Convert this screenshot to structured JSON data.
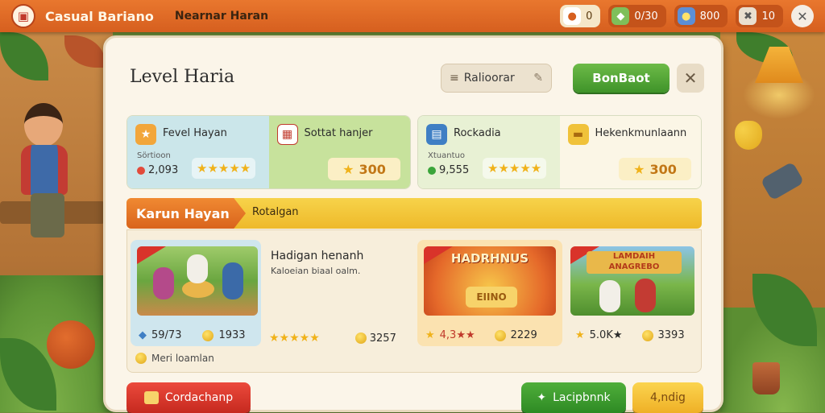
{
  "topbar": {
    "app_title": "Casual Bariano",
    "sub_title": "Nearnar Haran",
    "stats": [
      {
        "icon": "ticket-icon",
        "value": "0",
        "bg": "#f5e6c8"
      },
      {
        "icon": "gem-icon",
        "value": "0/30",
        "bg": "#7fbf5a"
      },
      {
        "icon": "coins-icon",
        "value": "800",
        "bg": "#5c8fd6"
      },
      {
        "icon": "tools-icon",
        "value": "10",
        "bg": "#e9dfcf"
      }
    ]
  },
  "header": {
    "title": "Level Haria",
    "search_value": "Ralioorar",
    "primary_button": "BonBaot"
  },
  "cards": [
    {
      "left": {
        "label": "Fevel Hayan",
        "small": "Sörtioon",
        "value": "2,093",
        "dot_color": "#e24b3b"
      },
      "right": {
        "label": "Sottat hanjer",
        "coins": "300"
      }
    },
    {
      "left": {
        "label": "Rockadia",
        "small": "Xtuantuo",
        "value": "9,555",
        "dot_color": "#3aa53a"
      },
      "right": {
        "label": "Hekenkmunlaann",
        "coins": "300"
      }
    }
  ],
  "section": {
    "tag": "Karun Hayan",
    "text": "Rotalgan"
  },
  "items": [
    {
      "thumb_text": "",
      "left_value": "59/73",
      "coin_value": "1933"
    },
    {
      "title": "Hadigan henanh",
      "desc": "Kaloeian biaal oalm.",
      "stars": "★★★★★",
      "coin_value": "3257"
    },
    {
      "thumb_text": "HADRHNUS",
      "thumb_sub": "EIINO",
      "rating": "4,3★★",
      "coin_value": "2229"
    },
    {
      "thumb_text": "LAMDAIH ANAGREBO",
      "rating": "5.0K★",
      "coin_value": "3393"
    }
  ],
  "list_footer": "Meri loamlan",
  "bottom": {
    "red_button": "Cordachanp",
    "green_button": "Lacipbnnk",
    "yellow_button": "4,ndig"
  },
  "colors": {
    "topbar": "#d65f1f",
    "primary_green": "#3f9329",
    "banner_yellow": "#eeb92a",
    "danger_red": "#c6291f"
  }
}
